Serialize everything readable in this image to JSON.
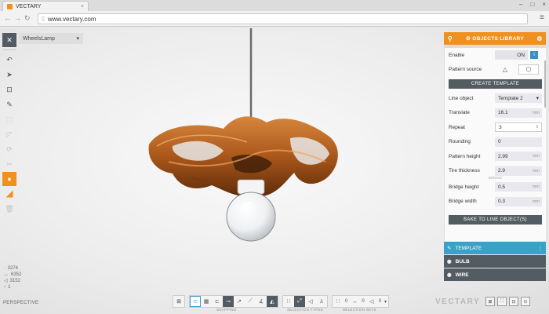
{
  "browser": {
    "tab_title": "VECTARY",
    "tab_close": "×",
    "url": "www.vectary.com",
    "minimize": "–",
    "maximize": "□",
    "close": "×"
  },
  "document": {
    "name": "WheelsLamp"
  },
  "stats": {
    "vertices": "3274",
    "edges": "6352",
    "faces": "3152",
    "objects": "1"
  },
  "viewport_label": "PERSPECTIVE",
  "bottom": {
    "snapping_label": "SNAPPING",
    "selection_types_label": "SELECTION TYPES",
    "selection_sets_label": "SELECTION SETS",
    "sets": [
      "0",
      "0",
      "0"
    ]
  },
  "logo": "VECTARY",
  "panel": {
    "title": "OBJECTS LIBRARY",
    "enable_label": "Enable",
    "enable_value": "ON",
    "pattern_source_label": "Pattern source",
    "create_template": "CREATE TEMPLATE",
    "line_object_label": "Line object",
    "line_object_value": "Template 2",
    "translate_label": "Translate",
    "translate_value": "16.1",
    "repeat_label": "Repeat",
    "repeat_value": "3",
    "rounding_label": "Rounding",
    "rounding_value": "0",
    "pattern_height_label": "Pattern height",
    "pattern_height_value": "2.99",
    "tire_thickness_label": "Tire thickness",
    "tire_thickness_value": "2.9",
    "bridge_label": "BRIDGE",
    "bridge_height_label": "Bridge height",
    "bridge_height_value": "0.5",
    "bridge_width_label": "Bridge width",
    "bridge_width_value": "0.3",
    "bake_button": "BAKE TO LINE OBJECT(S)",
    "unit": "mm",
    "layers": [
      "TEMPLATE",
      "BULB",
      "WIRE"
    ]
  },
  "colors": {
    "accent_orange": "#f0901e",
    "accent_blue": "#3da0c8",
    "dark_gray": "#535b63",
    "lamp_copper": "#b8621e"
  }
}
